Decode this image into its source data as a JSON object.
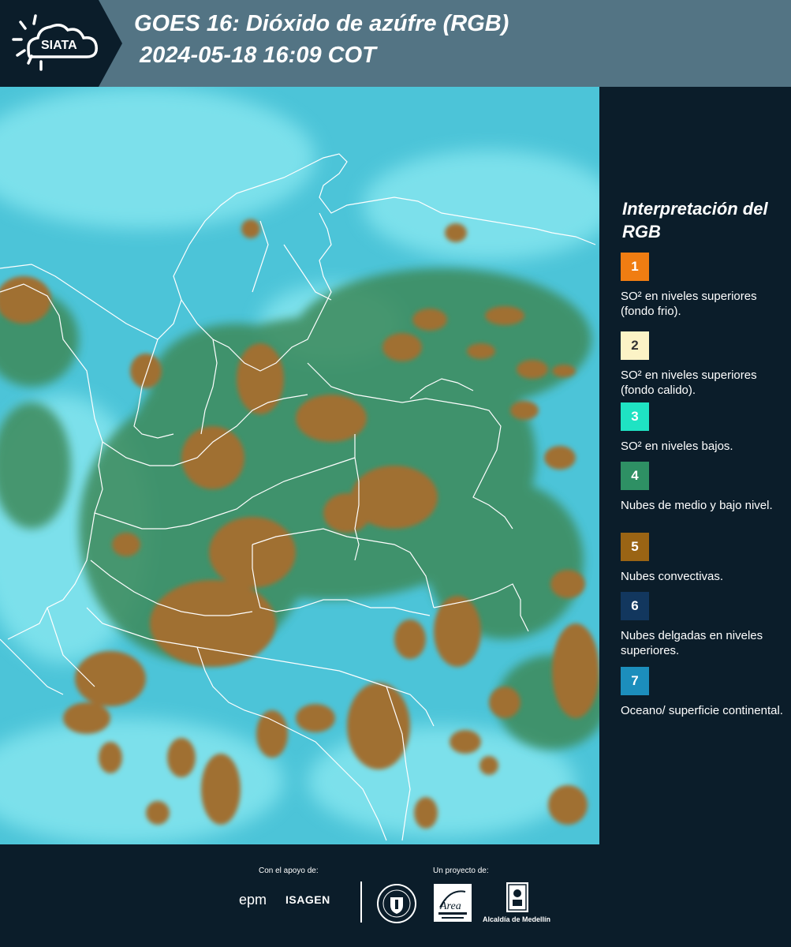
{
  "header": {
    "logo_text": "SIATA",
    "title_line1": "GOES 16: Dióxido de azúfre (RGB)",
    "title_line2": "2024-05-18 16:09 COT"
  },
  "legend": {
    "title": "Interpretación del RGB",
    "items": [
      {
        "number": "1",
        "color": "#f07d12",
        "label": "SO² en niveles superiores (fondo frio)."
      },
      {
        "number": "2",
        "color": "#fcf3c6",
        "label": "SO² en niveles superiores (fondo calido)."
      },
      {
        "number": "3",
        "color": "#1fe3c3",
        "label": "SO² en niveles bajos."
      },
      {
        "number": "4",
        "color": "#2e9064",
        "label": "Nubes de medio y bajo nivel."
      },
      {
        "number": "5",
        "color": "#9a6414",
        "label": "Nubes convectivas."
      },
      {
        "number": "6",
        "color": "#12375e",
        "label": "Nubes delgadas en niveles superiores."
      },
      {
        "number": "7",
        "color": "#1c8ebc",
        "label": "Oceano/ superficie continental."
      }
    ]
  },
  "footer": {
    "support_caption": "Con el apoyo de:",
    "project_caption": "Un proyecto de:",
    "epm_logo": "epm",
    "isagen_logo": "ISAGEN",
    "area_logo": "Área Metropolitana Valle de Aburrá",
    "alcaldia_logo": "Alcaldía de Medellín"
  },
  "map_colors": {
    "background": "#4cc4d8",
    "clear_sky": "#7ee6f0",
    "green_cloud": "#3d8a5a",
    "convective": "#a07030",
    "borders": "#ffffff"
  }
}
